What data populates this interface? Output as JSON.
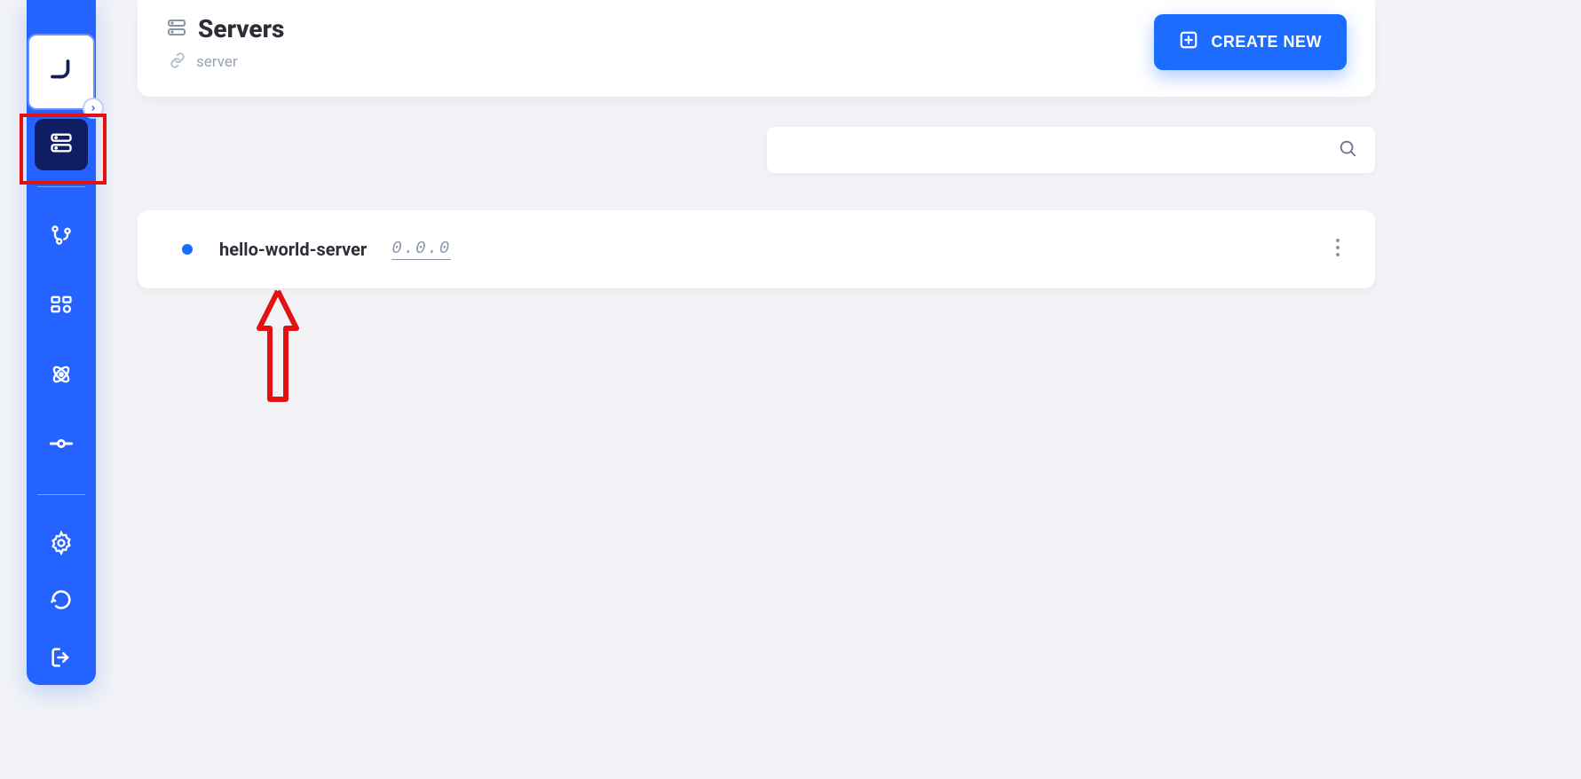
{
  "sidebar": {
    "items": [
      {
        "name": "servers-icon",
        "active": true
      },
      {
        "name": "branches-icon"
      },
      {
        "name": "components-icon"
      },
      {
        "name": "atom-icon"
      },
      {
        "name": "commit-icon"
      }
    ],
    "bottom_items": [
      {
        "name": "settings-icon"
      },
      {
        "name": "history-icon"
      },
      {
        "name": "logout-icon"
      }
    ]
  },
  "header": {
    "title": "Servers",
    "subtitle": "server",
    "create_label": "CREATE NEW"
  },
  "search": {
    "value": "",
    "placeholder": ""
  },
  "servers": [
    {
      "name": "hello-world-server",
      "version": "0.0.0"
    }
  ]
}
